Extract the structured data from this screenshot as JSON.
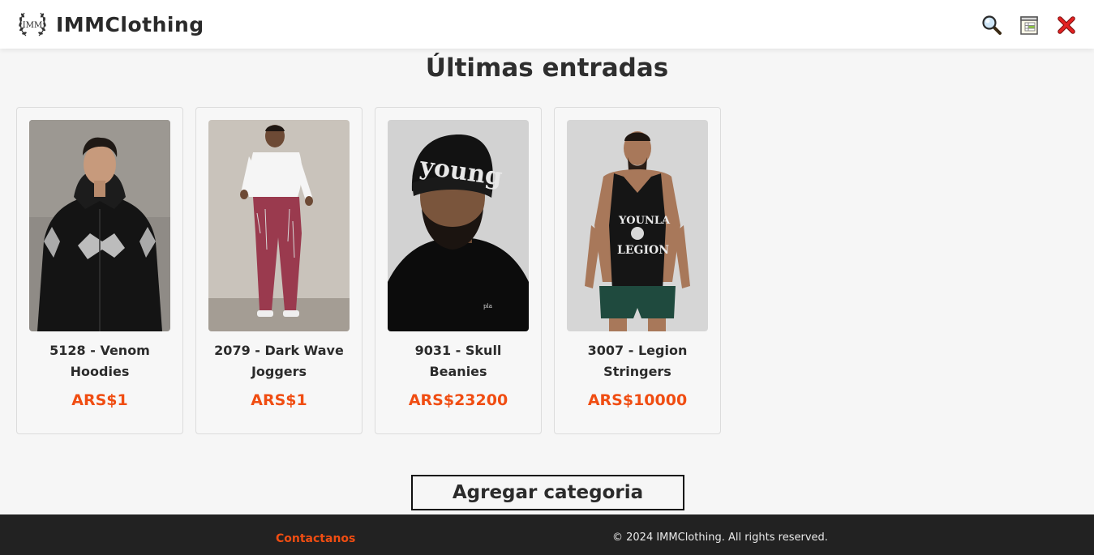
{
  "header": {
    "logo_text": "IMM",
    "brand": "IMMClothing",
    "icons": [
      "search-icon",
      "catalog-icon",
      "close-icon"
    ]
  },
  "main": {
    "title": "Últimas entradas",
    "products": [
      {
        "name": "5128 - Venom Hoodies",
        "price": "ARS$1",
        "image": "black-zip-hoodie-photo"
      },
      {
        "name": "2079 - Dark Wave Joggers",
        "price": "ARS$1",
        "image": "burgundy-joggers-photo"
      },
      {
        "name": "9031 - Skull Beanies",
        "price": "ARS$23200",
        "image": "black-beanie-photo"
      },
      {
        "name": "3007 - Legion Stringers",
        "price": "ARS$10000",
        "image": "black-stringer-tank-photo"
      }
    ],
    "add_category_label": "Agregar categoria"
  },
  "footer": {
    "contact_label": "Contactanos",
    "copyright": "© 2024 IMMClothing. All rights reserved."
  },
  "colors": {
    "accent": "#f04d12",
    "footer_bg": "#222222",
    "page_bg": "#f6f6f6"
  }
}
